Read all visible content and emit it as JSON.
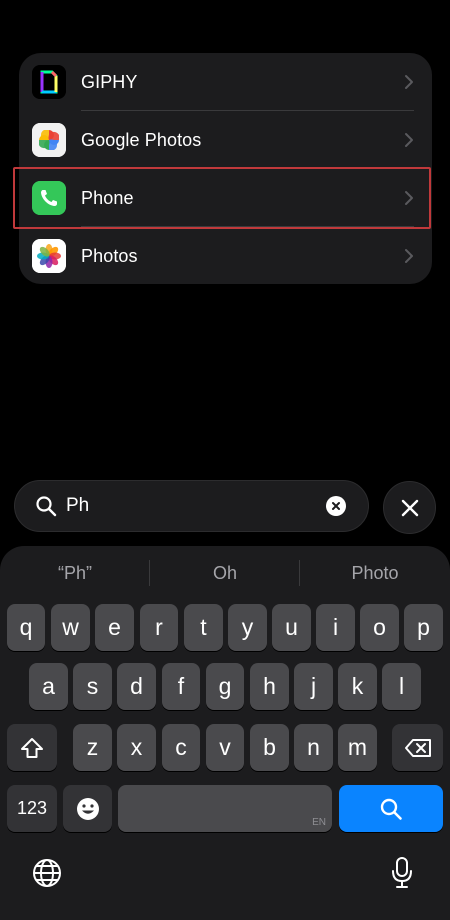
{
  "apps": [
    {
      "name": "GIPHY",
      "icon": "giphy-icon"
    },
    {
      "name": "Google Photos",
      "icon": "google-photos-icon"
    },
    {
      "name": "Phone",
      "icon": "phone-icon",
      "highlighted": true
    },
    {
      "name": "Photos",
      "icon": "photos-icon"
    }
  ],
  "search": {
    "value": "Ph"
  },
  "suggestions": [
    "“Ph”",
    "Oh",
    "Photo"
  ],
  "keyboard": {
    "row1": [
      "q",
      "w",
      "e",
      "r",
      "t",
      "y",
      "u",
      "i",
      "o",
      "p"
    ],
    "row2": [
      "a",
      "s",
      "d",
      "f",
      "g",
      "h",
      "j",
      "k",
      "l"
    ],
    "row3": [
      "z",
      "x",
      "c",
      "v",
      "b",
      "n",
      "m"
    ],
    "numbers_label": "123",
    "space_lang": "EN"
  },
  "colors": {
    "accent": "#0a84ff",
    "highlight_border": "#c0393b",
    "phone_green": "#34c759"
  }
}
